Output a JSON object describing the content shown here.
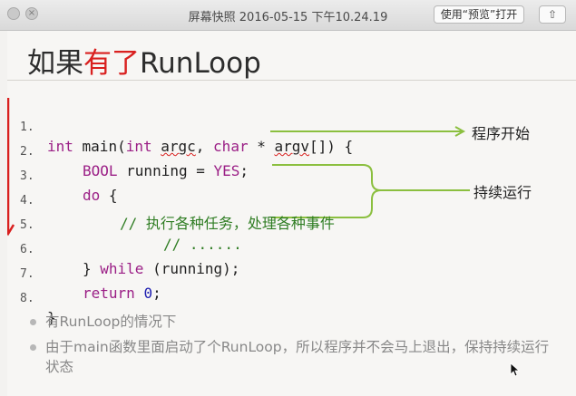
{
  "window": {
    "title": "屏幕快照 2016-05-15 下午10.24.19",
    "open_button": "使用“预览”打开",
    "close_icon": "×",
    "share_icon": "⇧"
  },
  "slide": {
    "title_prefix": "如果",
    "title_highlight": "有了",
    "title_suffix": "RunLoop",
    "code": [
      {
        "num": "1."
      },
      {
        "num": "2."
      },
      {
        "num": "3."
      },
      {
        "num": "4."
      },
      {
        "num": "5."
      },
      {
        "num": "6."
      },
      {
        "num": "7."
      },
      {
        "num": "8."
      }
    ],
    "code_tokens": {
      "l1_int": "int",
      "l1_main": " main(",
      "l1_int2": "int",
      "l1_argc_sp": " ",
      "l1_argc": "argc",
      "l1_comma": ", ",
      "l1_char": "char",
      "l1_star": " * ",
      "l1_argv": "argv",
      "l1_end": "[]) {",
      "l2_bool": "BOOL",
      "l2_mid": " running = ",
      "l2_yes": "YES",
      "l2_end": ";",
      "l3_do": "do",
      "l3_end": " {",
      "l4_comment": "// 执行各种任务，处理各种事件",
      "l5_comment": "// ......",
      "l6_pre": "} ",
      "l6_while": "while",
      "l6_end": " (running);",
      "l7_return": "return",
      "l7_sp": " ",
      "l7_zero": "0",
      "l7_end": ";",
      "l8": "}"
    },
    "note_start": "程序开始",
    "note_loop": "持续运行",
    "bullets": [
      "有RunLoop的情况下",
      "由于main函数里面启动了个RunLoop，所以程序并不会马上退出，保持持续运行状态"
    ]
  },
  "colors": {
    "accent_red": "#d9201f",
    "annotation_green": "#8bbf3f"
  }
}
